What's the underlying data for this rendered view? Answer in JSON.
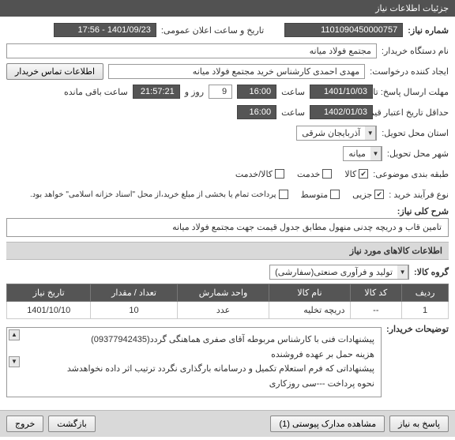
{
  "window": {
    "title": "جزئیات اطلاعات نیاز"
  },
  "fields": {
    "need_no_label": "شماره نیاز:",
    "need_no": "1101090450000757",
    "announce_label": "تاریخ و ساعت اعلان عمومی:",
    "announce_value": "1401/09/23 - 17:56",
    "buyer_org_label": "نام دستگاه خریدار:",
    "buyer_org": "مجتمع فولاد میانه",
    "requester_label": "ایجاد کننده درخواست:",
    "requester": "مهدی احمدی کارشناس خرید مجتمع فولاد میانه",
    "contact_btn": "اطلاعات تماس خریدار",
    "reply_deadline_label": "حداقل تاریخ اعتبار قیمت: تا تاریخ:",
    "reply_deadline_date": "1401/10/03",
    "time_label": "ساعت",
    "reply_deadline_time": "16:00",
    "days": "9",
    "days_label": "روز و",
    "countdown": "21:57:21",
    "remain_label": "ساعت باقی مانده",
    "send_deadline_label": "مهلت ارسال پاسخ: تا تاریخ:",
    "send_deadline_date": "1402/01/03",
    "send_deadline_time": "16:00",
    "province_label": "استان محل تحویل:",
    "province": "آذربایجان شرقی",
    "city_label": "شهر محل تحویل:",
    "city": "میانه",
    "category_label": "طبقه بندی موضوعی:",
    "cat_goods": "کالا",
    "cat_service": "خدمت",
    "cat_goods_service": "کالا/خدمت",
    "process_label": "نوع فرآیند خرید :",
    "proc_small": "جزیی",
    "proc_medium": "متوسط",
    "proc_note": "پرداخت تمام یا بخشی از مبلغ خرید،از محل \"اسناد خزانه اسلامی\" خواهد بود.",
    "desc_label": "شرح کلی نیاز:",
    "desc": "تامین قاب و دریچه چدنی منهول مطابق جدول قیمت جهت مجتمع فولاد میانه"
  },
  "items_section": {
    "title": "اطلاعات کالاهای مورد نیاز",
    "group_label": "گروه کالا:",
    "group": "تولید و فرآوری صنعتی(سفارشی)"
  },
  "table": {
    "headers": [
      "ردیف",
      "کد کالا",
      "نام کالا",
      "واحد شمارش",
      "تعداد / مقدار",
      "تاریخ نیاز"
    ],
    "row": [
      "1",
      "--",
      "دریچه تخلیه",
      "عدد",
      "10",
      "1401/10/10"
    ]
  },
  "notes": {
    "label": "توضیحات خریدار:",
    "lines": [
      "پیشنهادات فنی با کارشناس مربوطه آقای صفری هماهنگی گردد(09377942435)",
      "هزینه حمل بر عهده فروشنده",
      "پیشنهاداتی که فرم استعلام تکمیل و درسامانه بارگذاری نگردد ترتیب اثر داده نخواهدشد",
      "نحوه پرداخت ---سی روزکاری"
    ]
  },
  "footer": {
    "reply": "پاسخ به نیاز",
    "attachments": "مشاهده مدارک پیوستی (1)",
    "back": "بازگشت",
    "exit": "خروج"
  }
}
